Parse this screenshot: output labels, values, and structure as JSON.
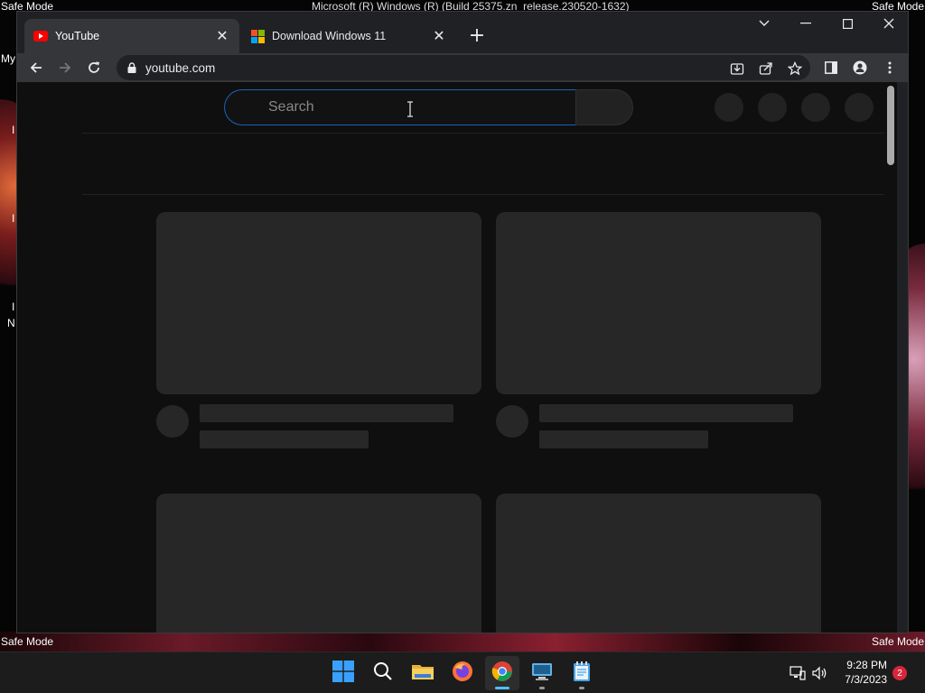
{
  "desktop": {
    "safe_mode_label": "Safe Mode",
    "build_text": "Microsoft (R) Windows (R) (Build 25375.zn_release.230520-1632)",
    "desktop_fragments": [
      "My",
      "I",
      "I",
      "I",
      "N"
    ]
  },
  "browser": {
    "tabs": [
      {
        "title": "YouTube",
        "favicon": "youtube-icon",
        "active": true
      },
      {
        "title": "Download Windows 11",
        "favicon": "windows-icon",
        "active": false
      }
    ],
    "address": "youtube.com"
  },
  "page": {
    "search_placeholder": "Search",
    "search_value": ""
  },
  "taskbar": {
    "apps": [
      "windows-start-icon",
      "search-icon",
      "file-explorer-icon",
      "firefox-icon",
      "chrome-icon",
      "remote-desktop-icon",
      "notepad-icon"
    ],
    "time": "9:28 PM",
    "date": "7/3/2023",
    "notification_count": "2"
  },
  "colors": {
    "accent_blue": "#1c62b9",
    "youtube_red": "#ff0000",
    "notification_red": "#d7263d"
  }
}
